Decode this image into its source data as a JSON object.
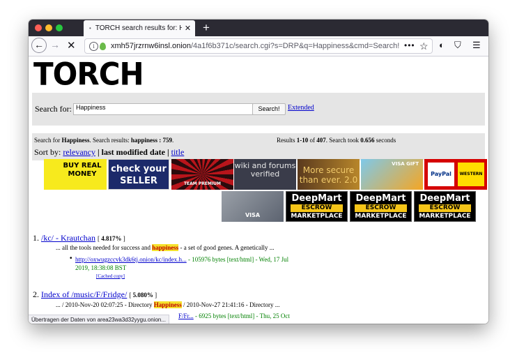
{
  "browser": {
    "tab_title": "TORCH search results for: Happ",
    "tab_favicon": "•",
    "tab_close": "✕",
    "new_tab": "+",
    "url_host": "xmh57jrzrnw6insl.onion",
    "url_path": "/4a1f6b371c/search.cgi?s=DRP&q=Happiness&cmd=Search!",
    "url_more": "•••",
    "status_text": "Übertragen der Daten von area23wa3d32yygu.onion..."
  },
  "page": {
    "logo_text": "TORCH",
    "search_label": "Search for:",
    "search_value": "Happiness",
    "search_button": "Search!",
    "extended_link": "Extended",
    "summary": {
      "search_for_prefix": "Search for ",
      "query": "Happiness",
      "mid": ". Search results: ",
      "results_query": "happiness : 759",
      "end": ".",
      "results_prefix": "Results ",
      "range": "1-10",
      "of": " of ",
      "total": "407",
      "took": ". Search took ",
      "seconds": "0.656",
      "seconds_suffix": " seconds"
    },
    "sort": {
      "label": "Sort by: ",
      "relevancy": "relevancy",
      "sep1": " | ",
      "last_modified": "last modified date",
      "sep2": " | ",
      "title": "title"
    },
    "ads": {
      "buy_real_money": "BUY REAL MONEY",
      "check_seller": "check your SELLER",
      "team_premium": "TEAM PREMIUM",
      "wiki_forums": "wiki and forums verified",
      "more_secure": "More secure than ever. 2.0",
      "visa_gift": "VISA GIFT",
      "paypal": "PayPal",
      "western_union": "WESTERN UNION",
      "visa_cards": "VISA",
      "deepmart": "DeepMart",
      "escrow": "ESCROW",
      "marketplace": "MARKETPLACE"
    },
    "results": [
      {
        "number": "1.",
        "title": "/kc/ - Krautchan",
        "score": "4.817%",
        "snippet_before": "... all the tools needed for success and ",
        "snippet_highlight": "happiness",
        "snippet_after": " - a set of good genes. A genetically ...",
        "link": "http://oxwugzccvk3dk6tj.onion/kc/index.h...",
        "meta": " - 105976 bytes [text/html] - Wed, 17 Jul",
        "meta2": "2019, 18:38:08 BST",
        "cached": "[Cached copy]"
      },
      {
        "number": "2.",
        "title": "Index of /music/F/Fridge/",
        "score": "5.080%",
        "snippet_before": "... / 2010-Nov-20 02:07:25 - Directory ",
        "snippet_highlight": "Happiness",
        "snippet_after": " / 2010-Nov-27 21:41:16 - Directory ...",
        "link": "F/Fr...",
        "meta": " - 6925 bytes [text/html] - Thu, 25 Oct"
      }
    ]
  }
}
